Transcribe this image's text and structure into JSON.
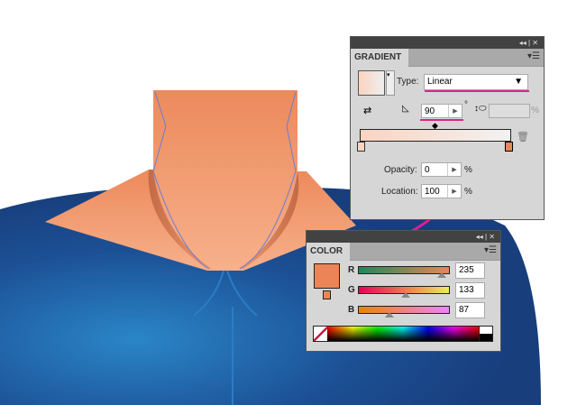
{
  "gradient_panel": {
    "title": "GRADIENT",
    "type_label": "Type:",
    "type_value": "Linear",
    "angle_value": "90",
    "degree_symbol": "°",
    "percent": "%",
    "opacity_label": "Opacity:",
    "opacity_value": "0",
    "location_label": "Location:",
    "location_value": "100",
    "titlebar_controls": "◂◂ | ✕"
  },
  "color_panel": {
    "title": "COLOR",
    "titlebar_controls": "◂◂ | ✕",
    "swatch_color": "#eb8557",
    "channels": [
      {
        "label": "R",
        "value": "235",
        "fraction": 0.92
      },
      {
        "label": "G",
        "value": "133",
        "fraction": 0.52
      },
      {
        "label": "B",
        "value": "87",
        "fraction": 0.34
      }
    ]
  },
  "colors": {
    "skin": "#eb8557",
    "suit": "#1e5fa8",
    "annotation": "#e0208f"
  }
}
